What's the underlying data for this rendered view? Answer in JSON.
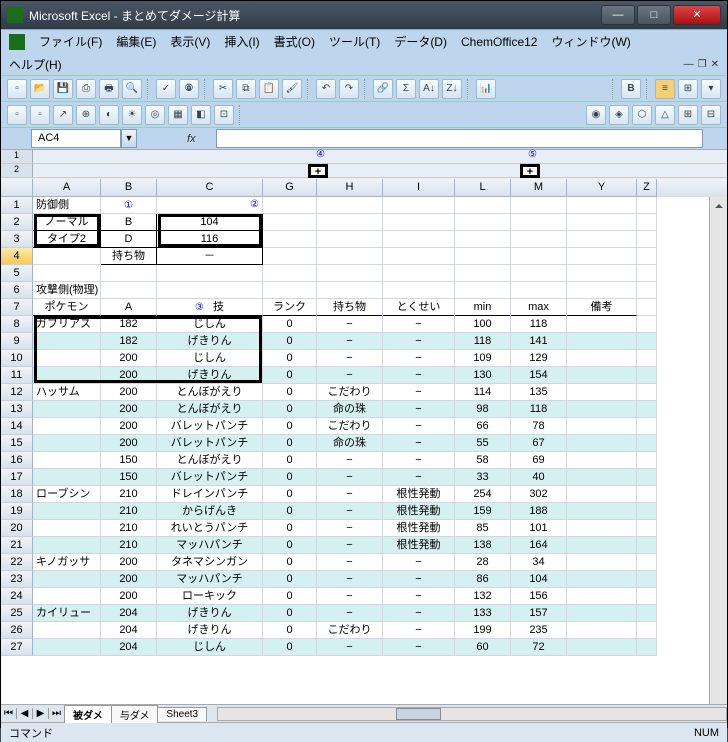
{
  "window": {
    "title": "Microsoft Excel - まとめてダメージ計算"
  },
  "menu": {
    "file": "ファイル(F)",
    "edit": "編集(E)",
    "view": "表示(V)",
    "insert": "挿入(I)",
    "format": "書式(O)",
    "tools": "ツール(T)",
    "data": "データ(D)",
    "chem": "ChemOffice12",
    "window": "ウィンドウ(W)",
    "help": "ヘルプ(H)"
  },
  "namebox": "AC4",
  "fx": "fx",
  "outline": {
    "c4": "④",
    "c5": "⑤"
  },
  "columns": [
    "A",
    "B",
    "C",
    "G",
    "H",
    "I",
    "L",
    "M",
    "Y",
    "Z"
  ],
  "headerBlock": {
    "r1": {
      "A": "防御側",
      "circ1": "①",
      "circ2": "②"
    },
    "r2": {
      "A": "ノーマル",
      "B": "B",
      "C": "104"
    },
    "r3": {
      "A": "タイプ2",
      "B": "D",
      "C": "116"
    },
    "r4": {
      "B": "持ち物",
      "C": "－"
    },
    "r6": {
      "A": "攻撃側(物理)"
    },
    "r7": {
      "A": "ポケモン",
      "B": "A",
      "circ3": "③",
      "C": "技",
      "G": "ランク",
      "H": "持ち物",
      "I": "とくせい",
      "L": "min",
      "M": "max",
      "Y": "備考"
    }
  },
  "rows": [
    {
      "n": 8,
      "A": "ガブリアス",
      "B": 182,
      "C": "じしん",
      "G": 0,
      "H": "−",
      "I": "−",
      "L": 100,
      "M": 118
    },
    {
      "n": 9,
      "A": "",
      "B": 182,
      "C": "げきりん",
      "G": 0,
      "H": "−",
      "I": "−",
      "L": 118,
      "M": 141,
      "band": true
    },
    {
      "n": 10,
      "A": "",
      "B": 200,
      "C": "じしん",
      "G": 0,
      "H": "−",
      "I": "−",
      "L": 109,
      "M": 129
    },
    {
      "n": 11,
      "A": "",
      "B": 200,
      "C": "げきりん",
      "G": 0,
      "H": "−",
      "I": "−",
      "L": 130,
      "M": 154,
      "band": true
    },
    {
      "n": 12,
      "A": "ハッサム",
      "B": 200,
      "C": "とんぼがえり",
      "G": 0,
      "H": "こだわり",
      "I": "−",
      "L": 114,
      "M": 135
    },
    {
      "n": 13,
      "A": "",
      "B": 200,
      "C": "とんぼがえり",
      "G": 0,
      "H": "命の珠",
      "I": "−",
      "L": 98,
      "M": 118,
      "band": true
    },
    {
      "n": 14,
      "A": "",
      "B": 200,
      "C": "バレットパンチ",
      "G": 0,
      "H": "こだわり",
      "I": "−",
      "L": 66,
      "M": 78
    },
    {
      "n": 15,
      "A": "",
      "B": 200,
      "C": "バレットパンチ",
      "G": 0,
      "H": "命の珠",
      "I": "−",
      "L": 55,
      "M": 67,
      "band": true
    },
    {
      "n": 16,
      "A": "",
      "B": 150,
      "C": "とんぼがえり",
      "G": 0,
      "H": "−",
      "I": "−",
      "L": 58,
      "M": 69
    },
    {
      "n": 17,
      "A": "",
      "B": 150,
      "C": "バレットパンチ",
      "G": 0,
      "H": "−",
      "I": "−",
      "L": 33,
      "M": 40,
      "band": true
    },
    {
      "n": 18,
      "A": "ローブシン",
      "B": 210,
      "C": "ドレインパンチ",
      "G": 0,
      "H": "−",
      "I": "根性発動",
      "L": 254,
      "M": 302
    },
    {
      "n": 19,
      "A": "",
      "B": 210,
      "C": "からげんき",
      "G": 0,
      "H": "−",
      "I": "根性発動",
      "L": 159,
      "M": 188,
      "band": true
    },
    {
      "n": 20,
      "A": "",
      "B": 210,
      "C": "れいとうパンチ",
      "G": 0,
      "H": "−",
      "I": "根性発動",
      "L": 85,
      "M": 101
    },
    {
      "n": 21,
      "A": "",
      "B": 210,
      "C": "マッハパンチ",
      "G": 0,
      "H": "−",
      "I": "根性発動",
      "L": 138,
      "M": 164,
      "band": true
    },
    {
      "n": 22,
      "A": "キノガッサ",
      "B": 200,
      "C": "タネマシンガン",
      "G": 0,
      "H": "−",
      "I": "−",
      "L": 28,
      "M": 34
    },
    {
      "n": 23,
      "A": "",
      "B": 200,
      "C": "マッハパンチ",
      "G": 0,
      "H": "−",
      "I": "−",
      "L": 86,
      "M": 104,
      "band": true
    },
    {
      "n": 24,
      "A": "",
      "B": 200,
      "C": "ローキック",
      "G": 0,
      "H": "−",
      "I": "−",
      "L": 132,
      "M": 156
    },
    {
      "n": 25,
      "A": "カイリュー",
      "B": 204,
      "C": "げきりん",
      "G": 0,
      "H": "−",
      "I": "−",
      "L": 133,
      "M": 157,
      "band": true
    },
    {
      "n": 26,
      "A": "",
      "B": 204,
      "C": "げきりん",
      "G": 0,
      "H": "こだわり",
      "I": "−",
      "L": 199,
      "M": 235
    },
    {
      "n": 27,
      "A": "",
      "B": 204,
      "C": "じしん",
      "G": 0,
      "H": "−",
      "I": "−",
      "L": 60,
      "M": 72,
      "band": true
    }
  ],
  "tabs": {
    "t1": "被ダメ",
    "t2": "与ダメ",
    "t3": "Sheet3"
  },
  "status": {
    "left": "コマンド",
    "num": "NUM"
  }
}
